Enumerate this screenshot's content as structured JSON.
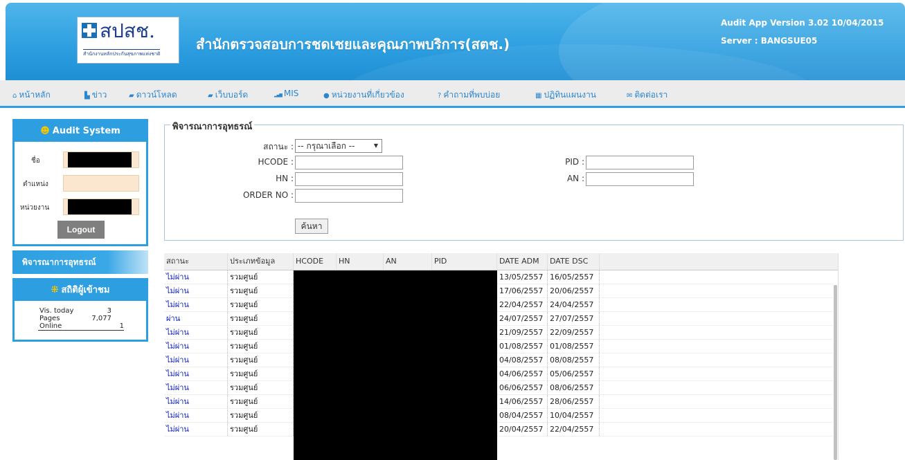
{
  "header": {
    "logo_text": "สปสช.",
    "logo_sub": "สำนักงานหลักประกันสุขภาพแห่งชาติ",
    "title": "สำนักตรวจสอบการชดเชยและคุณภาพบริการ(สตช.)",
    "version": "Audit App Version 3.02 10/04/2015",
    "server": "Server : BANGSUE05",
    "color": "#2c9ee0"
  },
  "nav": [
    {
      "label": "หน้าหลัก",
      "icon": "home-icon",
      "glyph": "⌂"
    },
    {
      "label": "ข่าว",
      "icon": "document-icon",
      "glyph": "▙"
    },
    {
      "label": "ดาวน์โหลด",
      "icon": "chat-icon",
      "glyph": "▰"
    },
    {
      "label": "เว็บบอร์ด",
      "icon": "comment-icon",
      "glyph": "▰"
    },
    {
      "label": "MIS",
      "icon": "signal-icon",
      "glyph": "▂▄▆"
    },
    {
      "label": "หน่วยงานที่เกี่ยวข้อง",
      "icon": "user-icon",
      "glyph": "●"
    },
    {
      "label": "คำถามที่พบบ่อย",
      "icon": "question-icon",
      "glyph": "?"
    },
    {
      "label": "ปฏิทินแผนงาน",
      "icon": "calendar-icon",
      "glyph": "▦"
    },
    {
      "label": "ติดต่อเรา",
      "icon": "mail-icon",
      "glyph": "✉"
    }
  ],
  "sidebar": {
    "audit_title": "Audit System",
    "name_label": "ชื่อ",
    "position_label": "ตำแหน่ง",
    "unit_label": "หน่วยงาน",
    "logout_label": "Logout",
    "consider_label": "พิจารณาการอุทธรณ์",
    "stats_title": "สถิติผู้เข้าชม",
    "stats": [
      {
        "k": "Vis. today",
        "v": "3"
      },
      {
        "k": "Pages",
        "v": "7,077"
      },
      {
        "k": "Online",
        "v": "1"
      }
    ]
  },
  "form": {
    "legend": "พิจารณาการอุทธรณ์",
    "status_label": "สถานะ :",
    "status_selected": "-- กรุณาเลือก --",
    "hcode_label": "HCODE :",
    "hn_label": "HN :",
    "order_label": "ORDER NO :",
    "pid_label": "PID :",
    "an_label": "AN :",
    "search_label": "ค้นหา"
  },
  "table": {
    "columns": [
      "สถานะ",
      "ประเภทข้อมูล",
      "HCODE",
      "HN",
      "AN",
      "PID",
      "DATE ADM",
      "DATE DSC"
    ],
    "rows": [
      [
        "ไม่ผ่าน",
        "รวมศูนย์",
        "13/05/2557",
        "16/05/2557"
      ],
      [
        "ไม่ผ่าน",
        "รวมศูนย์",
        "17/06/2557",
        "20/06/2557"
      ],
      [
        "ไม่ผ่าน",
        "รวมศูนย์",
        "22/04/2557",
        "24/04/2557"
      ],
      [
        "ผ่าน",
        "รวมศูนย์",
        "24/07/2557",
        "27/07/2557"
      ],
      [
        "ไม่ผ่าน",
        "รวมศูนย์",
        "21/09/2557",
        "22/09/2557"
      ],
      [
        "ไม่ผ่าน",
        "รวมศูนย์",
        "01/08/2557",
        "01/08/2557"
      ],
      [
        "ไม่ผ่าน",
        "รวมศูนย์",
        "04/08/2557",
        "08/08/2557"
      ],
      [
        "ไม่ผ่าน",
        "รวมศูนย์",
        "04/06/2557",
        "05/06/2557"
      ],
      [
        "ไม่ผ่าน",
        "รวมศูนย์",
        "06/06/2557",
        "08/06/2557"
      ],
      [
        "ไม่ผ่าน",
        "รวมศูนย์",
        "14/06/2557",
        "28/06/2557"
      ],
      [
        "ไม่ผ่าน",
        "รวมศูนย์",
        "08/04/2557",
        "10/04/2557"
      ],
      [
        "ไม่ผ่าน",
        "รวมศูนย์",
        "20/04/2557",
        "22/04/2557"
      ]
    ]
  }
}
